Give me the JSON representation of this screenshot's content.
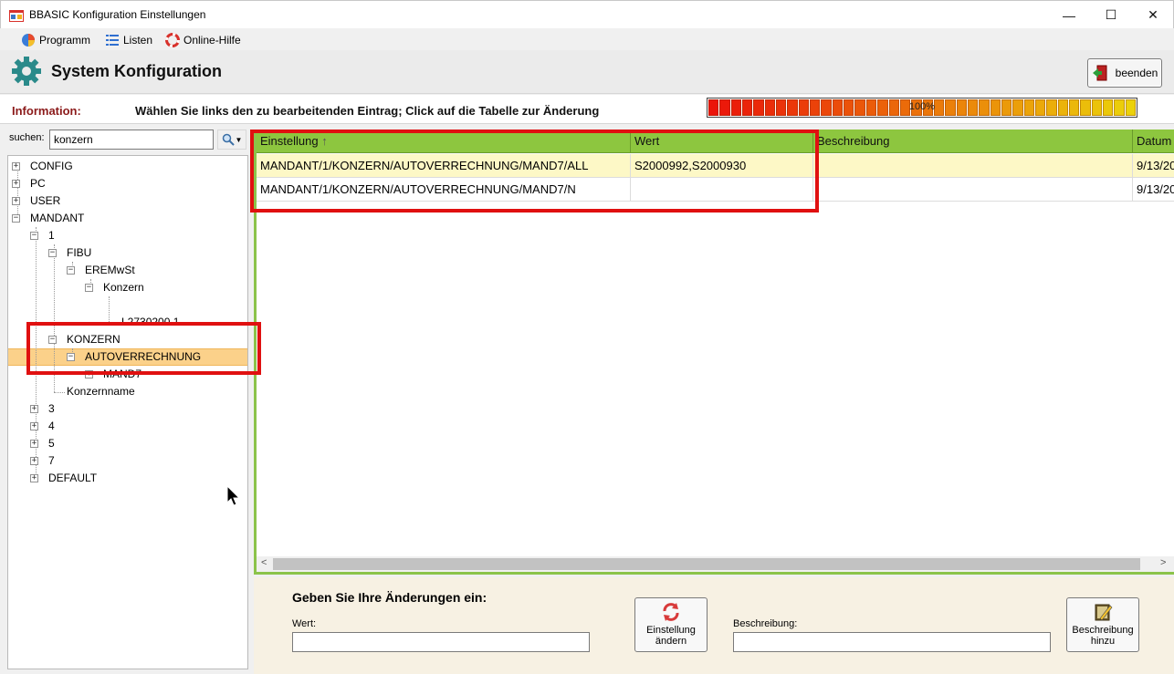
{
  "window": {
    "title": "BBASIC Konfiguration Einstellungen",
    "minimize": "—",
    "maximize": "☐",
    "close": "✕"
  },
  "menu": [
    {
      "label": "Programm",
      "icon": "program-icon"
    },
    {
      "label": "Listen",
      "icon": "list-icon"
    },
    {
      "label": "Online-Hilfe",
      "icon": "lifebuoy-icon"
    }
  ],
  "header": {
    "title": "System Konfiguration",
    "exit_label": "beenden"
  },
  "info": {
    "label": "Information:",
    "text": "Wählen Sie links den zu bearbeitenden Eintrag; Click auf die Tabelle zur Änderung",
    "progress_label": "100%",
    "progress_value": 100
  },
  "search": {
    "label": "suchen:",
    "value": "konzern"
  },
  "tree": {
    "nodes": [
      {
        "label": "CONFIG",
        "toggle": "+"
      },
      {
        "label": "PC",
        "toggle": "+"
      },
      {
        "label": "USER",
        "toggle": "+"
      },
      {
        "label": "MANDANT",
        "toggle": "−"
      },
      {
        "label": "1",
        "toggle": "−"
      },
      {
        "label": "FIBU",
        "toggle": "−"
      },
      {
        "label": "EREMwSt",
        "toggle": "−"
      },
      {
        "label": "Konzern",
        "toggle": "−"
      },
      {
        "label": "L2730200.1",
        "toggle": ""
      },
      {
        "label": "KONZERN",
        "toggle": "−"
      },
      {
        "label": "AUTOVERRECHNUNG",
        "toggle": "−"
      },
      {
        "label": "MAND7",
        "toggle": "+"
      },
      {
        "label": "Konzernname",
        "toggle": ""
      },
      {
        "label": "3",
        "toggle": "+"
      },
      {
        "label": "4",
        "toggle": "+"
      },
      {
        "label": "5",
        "toggle": "+"
      },
      {
        "label": "7",
        "toggle": "+"
      },
      {
        "label": "DEFAULT",
        "toggle": "+"
      }
    ]
  },
  "grid": {
    "columns": [
      "Einstellung",
      "Wert",
      "Beschreibung",
      "Datum"
    ],
    "sort_indicator": "↑",
    "rows": [
      {
        "einstellung": "MANDANT/1/KONZERN/AUTOVERRECHNUNG/MAND7/ALL",
        "wert": "S2000992,S2000930",
        "beschreibung": "",
        "datum": "9/13/20"
      },
      {
        "einstellung": "MANDANT/1/KONZERN/AUTOVERRECHNUNG/MAND7/N",
        "wert": "",
        "beschreibung": "",
        "datum": "9/13/20"
      }
    ],
    "scroll_left": "<",
    "scroll_right": ">"
  },
  "edit": {
    "title": "Geben Sie Ihre Änderungen ein:",
    "wert_label": "Wert:",
    "wert_value": "",
    "change_label_1": "Einstellung",
    "change_label_2": "ändern",
    "desc_label": "Beschreibung:",
    "desc_value": "",
    "add_desc_label_1": "Beschreibung",
    "add_desc_label_2": "hinzu"
  },
  "colors": {
    "grid_header": "#8dc63f",
    "selected_row": "#fdf8c6",
    "tree_selected": "#fbd18a",
    "highlight": "#e01010",
    "info_label": "#8b1a1a"
  }
}
